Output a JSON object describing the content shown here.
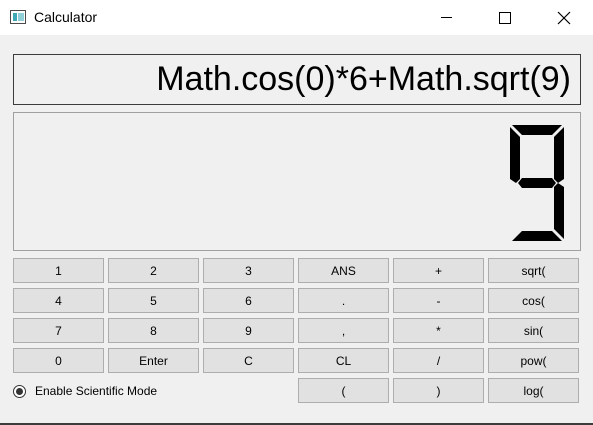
{
  "window": {
    "title": "Calculator"
  },
  "display": {
    "expression": "Math.cos(0)*6+Math.sqrt(9)",
    "result": "9"
  },
  "buttons": {
    "b1": "1",
    "b2": "2",
    "b3": "3",
    "ans": "ANS",
    "plus": "+",
    "sqrt": "sqrt(",
    "b4": "4",
    "b5": "5",
    "b6": "6",
    "dot": ".",
    "minus": "-",
    "cos": "cos(",
    "b7": "7",
    "b8": "8",
    "b9": "9",
    "comma": ",",
    "multiply": "*",
    "sin": "sin(",
    "b0": "0",
    "enter": "Enter",
    "clear": "C",
    "clear_line": "CL",
    "divide": "/",
    "pow": "pow(",
    "open_paren": "(",
    "close_paren": ")",
    "log": "log("
  },
  "scientific_mode": {
    "label": "Enable Scientific Mode",
    "checked": true
  },
  "icons": {
    "app": "calculator-app-icon",
    "minimize": "minimize-icon",
    "maximize": "maximize-icon",
    "close": "close-icon"
  }
}
